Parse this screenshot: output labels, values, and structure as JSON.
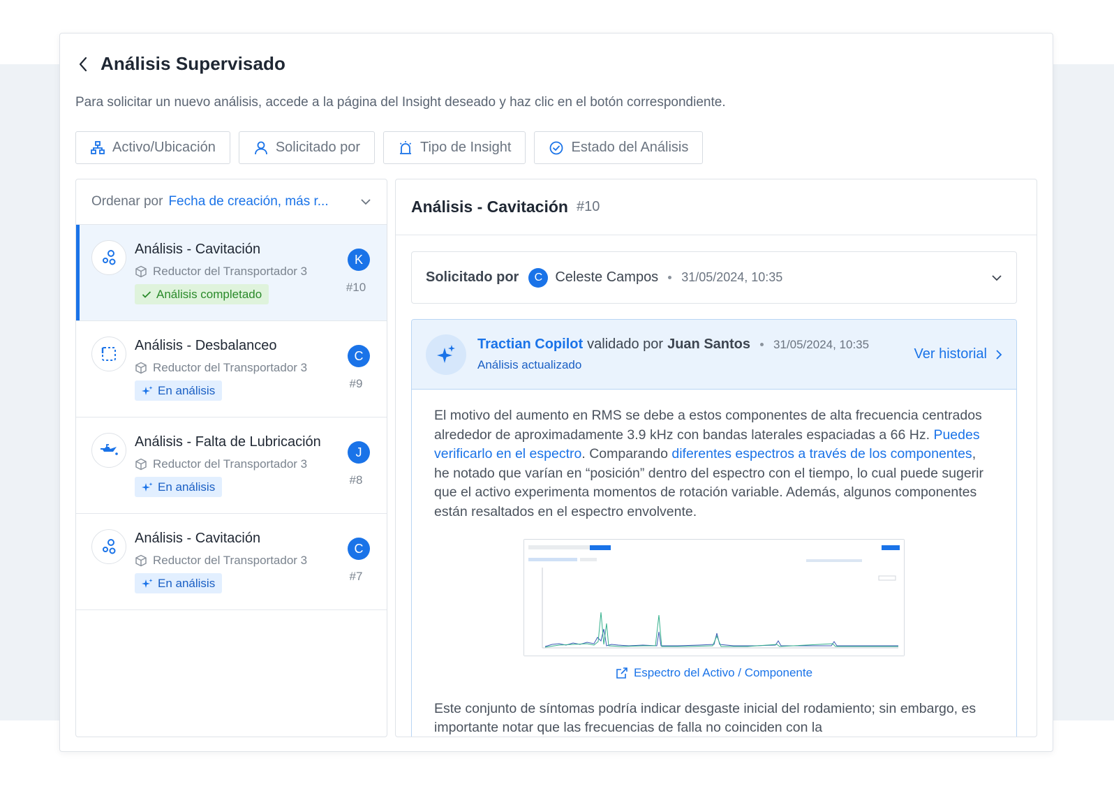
{
  "page": {
    "title": "Análisis Supervisado",
    "subtitle": "Para solicitar un nuevo análisis, accede a la página del Insight deseado y haz clic en el botón correspondiente."
  },
  "filters": [
    {
      "label": "Activo/Ubicación",
      "icon": "hierarchy-icon"
    },
    {
      "label": "Solicitado por",
      "icon": "user-icon"
    },
    {
      "label": "Tipo de Insight",
      "icon": "alarm-icon"
    },
    {
      "label": "Estado del Análisis",
      "icon": "check-circle-icon"
    }
  ],
  "sort": {
    "label": "Ordenar por",
    "value": "Fecha de creación, más r..."
  },
  "list": [
    {
      "title": "Análisis - Cavitación",
      "asset": "Reductor del Transportador 3",
      "status": "Análisis completado",
      "status_type": "done",
      "avatar": "K",
      "number": "#10",
      "icon": "bubbles-icon"
    },
    {
      "title": "Análisis - Desbalanceo",
      "asset": "Reductor del Transportador 3",
      "status": "En análisis",
      "status_type": "progress",
      "avatar": "C",
      "number": "#9",
      "icon": "unbalance-icon"
    },
    {
      "title": "Análisis - Falta de Lubricación",
      "asset": "Reductor del Transportador 3",
      "status": "En análisis",
      "status_type": "progress",
      "avatar": "J",
      "number": "#8",
      "icon": "oil-can-icon"
    },
    {
      "title": "Análisis - Cavitación",
      "asset": "Reductor del Transportador 3",
      "status": "En análisis",
      "status_type": "progress",
      "avatar": "C",
      "number": "#7",
      "icon": "bubbles-icon"
    }
  ],
  "detail": {
    "title": "Análisis - Cavitación",
    "number": "#10",
    "requested_label": "Solicitado por",
    "requested_avatar": "C",
    "requested_name": "Celeste Campos",
    "requested_date": "31/05/2024, 10:35",
    "copilot": {
      "brand": "Tractian Copilot",
      "validated_by_text": "validado por",
      "validator": "Juan Santos",
      "date": "31/05/2024, 10:35",
      "status": "Análisis actualizado",
      "history_link": "Ver historial"
    },
    "body": {
      "p1_a": "El motivo del aumento en RMS se debe a estos componentes de alta frecuencia centrados alrededor de aproximadamente 3.9 kHz con bandas laterales espaciadas a 66 Hz. ",
      "link1": "Puedes verificarlo en el espectro",
      "p1_b": ". Comparando ",
      "link2": "diferentes espectros a través de los componentes",
      "p1_c": ", he notado que varían en “posición” dentro del espectro con el tiempo, lo cual puede sugerir que el activo experimenta momentos de rotación variable. Además, algunos componentes están resaltados en el espectro envolvente.",
      "spectrum_caption": "Espectro del Activo / Componente",
      "p2": "Este conjunto de síntomas podría indicar desgaste inicial del rodamiento; sin embargo, es importante notar que las frecuencias de falla no coinciden con la"
    }
  },
  "colors": {
    "accent": "#1a73e8",
    "done_bg": "#dff3dc",
    "done_text": "#2a8a2a",
    "progress_bg": "#e2efff"
  }
}
